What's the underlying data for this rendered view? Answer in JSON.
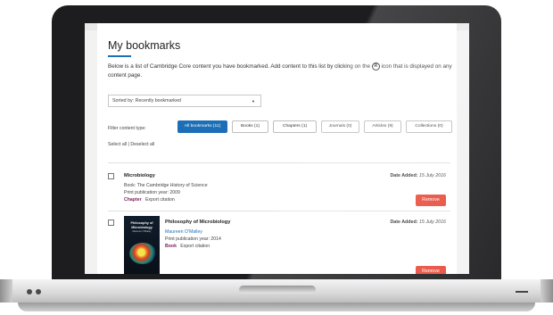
{
  "page": {
    "title": "My bookmarks",
    "intro_before_icon": "Below is a list of Cambridge Core content you have bookmarked. Add content to this list by clicking on the",
    "intro_icon_letter": "R",
    "intro_after_icon": "icon that is displayed on any content page."
  },
  "sort": {
    "selected": "Sorted by: Recently bookmarked",
    "caret_icon": "chevron-down-icon"
  },
  "filter": {
    "label": "Filter content type:",
    "buttons": [
      {
        "label": "All bookmarks (11)",
        "active": true
      },
      {
        "label": "Books (1)"
      },
      {
        "label": "Chapters (1)"
      },
      {
        "label": "Journals (0)"
      },
      {
        "label": "Articles (9)"
      },
      {
        "label": "Collections (0)"
      }
    ]
  },
  "selection": {
    "select_all": "Select all",
    "separator": "|",
    "deselect_all": "Deselect all"
  },
  "items": [
    {
      "title": "Microbiology",
      "book_line": "Book: The Cambridge History of Science",
      "pub_year": "Print publication year: 2009",
      "type": "Chapter",
      "export": "Export citation",
      "date_label": "Date Added:",
      "date_value": "15 July 2016",
      "remove": "Remove"
    },
    {
      "title": "Philosophy of Microbiology",
      "author": "Maureen O'Malley",
      "pub_year": "Print publication year: 2014",
      "type": "Book",
      "export": "Export citation",
      "date_label": "Date Added:",
      "date_value": "15 July 2016",
      "remove": "Remove",
      "cover_title": "Philosophy of Microbiology",
      "cover_author": "Maureen O'Malley"
    }
  ],
  "colors": {
    "accent": "#1c6fb6",
    "remove": "#e84b3a",
    "type_tag": "#7a1f5c"
  }
}
